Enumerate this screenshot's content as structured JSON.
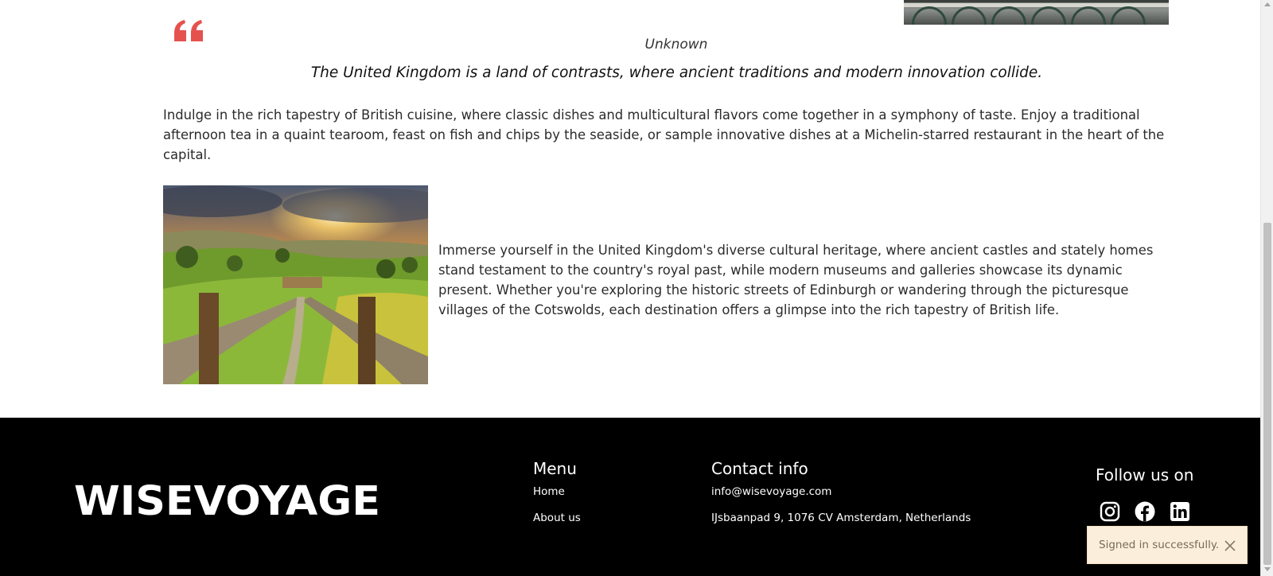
{
  "article": {
    "quote_author": "Unknown",
    "quote_text": "The United Kingdom is a land of contrasts, where ancient traditions and modern innovation collide.",
    "paragraph_cuisine": "Indulge in the rich tapestry of British cuisine, where classic dishes and multicultural flavors come together in a symphony of taste. Enjoy a traditional afternoon tea in a quaint tearoom, feast on fish and chips by the seaside, or sample innovative dishes at a Michelin-starred restaurant in the heart of the capital.",
    "paragraph_heritage": "Immerse yourself in the United Kingdom's diverse cultural heritage, where ancient castles and stately homes stand testament to the country's royal past, while modern museums and galleries showcase its dynamic present. Whether you're exploring the historic streets of Edinburgh or wandering through the picturesque villages of the Cotswolds, each destination offers a glimpse into the rich tapestry of British life."
  },
  "footer": {
    "logo_text": "WISEVOYAGE",
    "menu_title": "Menu",
    "menu_items": [
      "Home",
      "About us"
    ],
    "contact_title": "Contact info",
    "contact_email": "info@wisevoyage.com",
    "contact_address": "IJsbaanpad 9, 1076 CV Amsterdam, Netherlands",
    "follow_title": "Follow us on",
    "socials": [
      "instagram-icon",
      "facebook-icon",
      "linkedin-icon"
    ]
  },
  "toast": {
    "message": "Signed in successfully."
  },
  "colors": {
    "quote_accent": "#e5524e",
    "footer_bg": "#000000",
    "toast_bg": "#fbefdc"
  }
}
